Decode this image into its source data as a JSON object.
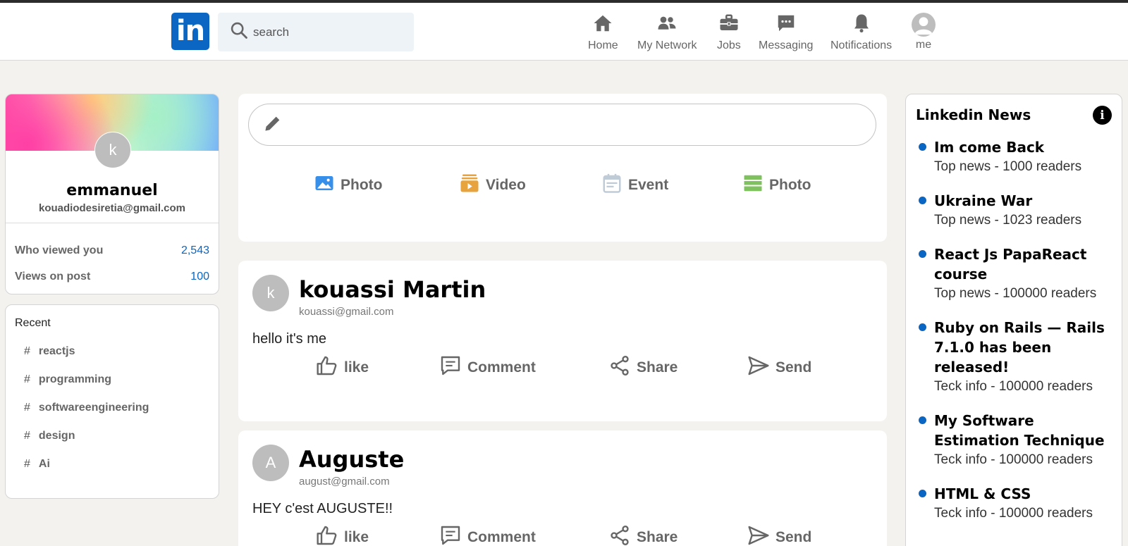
{
  "colors": {
    "brand": "#0a66c2",
    "icon_gray": "#666666",
    "photo_icon": "#378fe9",
    "video_icon": "#e7a33e",
    "event_icon": "#c0cbd8",
    "article_icon": "#7fc15e"
  },
  "header": {
    "logo_text": "in",
    "search": {
      "placeholder": "search",
      "icon": "search-icon"
    },
    "nav": [
      {
        "label": "Home",
        "icon": "home-icon"
      },
      {
        "label": "My Network",
        "icon": "people-icon"
      },
      {
        "label": "Jobs",
        "icon": "briefcase-icon"
      },
      {
        "label": "Messaging",
        "icon": "chat-icon"
      },
      {
        "label": "Notifications",
        "icon": "bell-icon"
      },
      {
        "label": "me",
        "icon": "avatar-icon"
      }
    ]
  },
  "sidebar": {
    "profile": {
      "avatar_letter": "k",
      "name": "emmanuel",
      "email": "kouadiodesiretia@gmail.com",
      "stats": [
        {
          "label": "Who viewed you",
          "value": "2,543"
        },
        {
          "label": "Views on post",
          "value": "100"
        }
      ]
    },
    "recent": {
      "title": "Recent",
      "items": [
        "reactjs",
        "programming",
        "softwareengineering",
        "design",
        "Ai"
      ]
    }
  },
  "composer": {
    "input_placeholder": "",
    "options": [
      {
        "label": "Photo",
        "icon": "image-icon"
      },
      {
        "label": "Video",
        "icon": "video-icon"
      },
      {
        "label": "Event",
        "icon": "calendar-icon"
      },
      {
        "label": "Photo",
        "icon": "article-icon"
      }
    ]
  },
  "posts": [
    {
      "avatar_letter": "k",
      "author": "kouassi Martin",
      "email": "kouassi@gmail.com",
      "message": "hello it's me"
    },
    {
      "avatar_letter": "A",
      "author": "Auguste",
      "email": "august@gmail.com",
      "message": "HEY c'est AUGUSTE!!"
    }
  ],
  "post_actions": [
    "like",
    "Comment",
    "Share",
    "Send"
  ],
  "news": {
    "title": "Linkedin News",
    "info_icon": "info-icon",
    "items": [
      {
        "heading": "Im come Back",
        "subtitle": "Top news - 1000 readers"
      },
      {
        "heading": "Ukraine War",
        "subtitle": "Top news - 1023 readers"
      },
      {
        "heading": "React Js PapaReact course",
        "subtitle": "Top news - 100000 readers"
      },
      {
        "heading": "Ruby on Rails — Rails 7.1.0 has been released!",
        "subtitle": "Teck info - 100000 readers"
      },
      {
        "heading": "My Software Estimation Technique",
        "subtitle": "Teck info - 100000 readers"
      },
      {
        "heading": "HTML & CSS",
        "subtitle": "Teck info - 100000 readers"
      }
    ]
  }
}
